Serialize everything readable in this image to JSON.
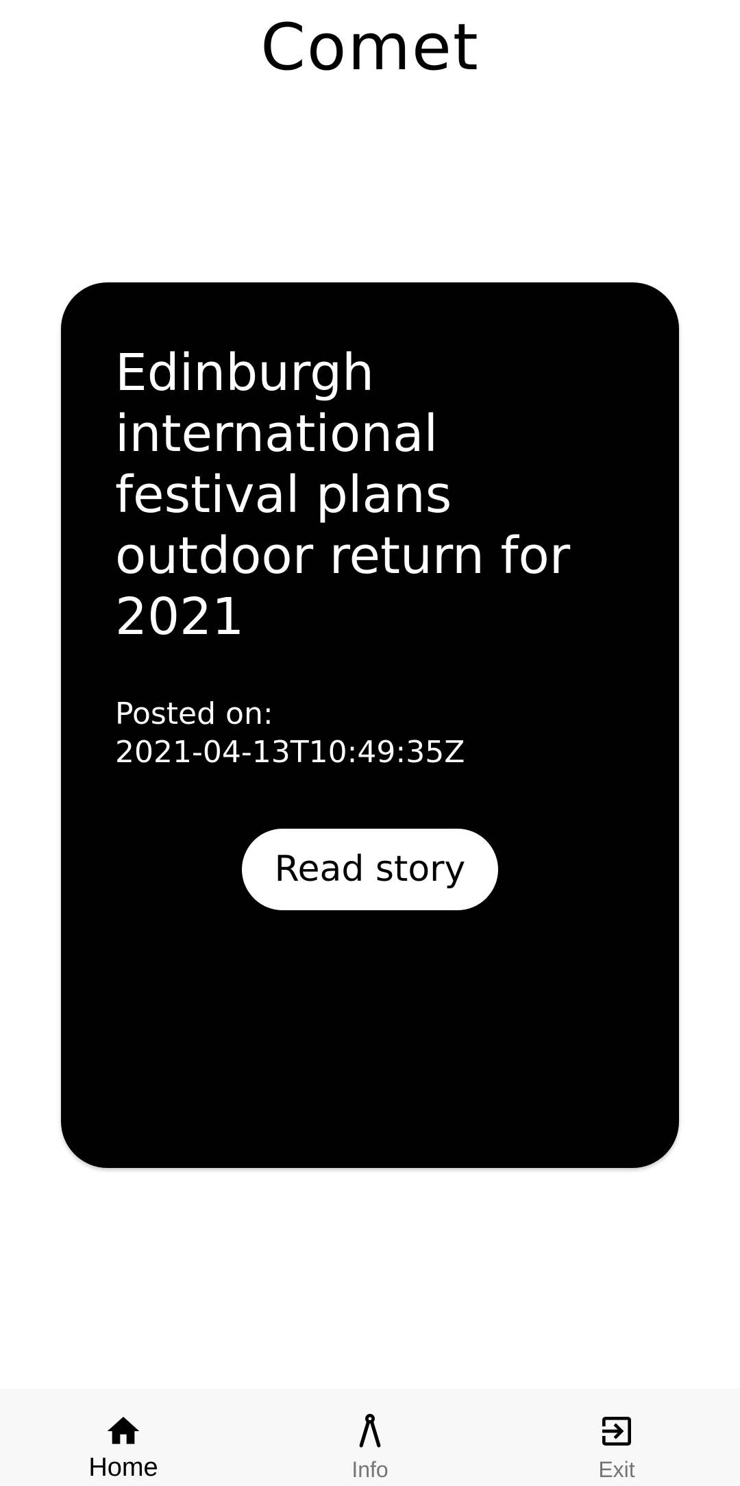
{
  "app": {
    "title": "Comet"
  },
  "story": {
    "title": "Edinburgh international festival plans outdoor return for 2021",
    "posted_label": "Posted on:",
    "posted_date": "2021-04-13T10:49:35Z",
    "read_button_label": "Read story"
  },
  "bottom_nav": {
    "items": [
      {
        "label": "Home",
        "icon": "home-icon",
        "active": true
      },
      {
        "label": "Info",
        "icon": "compass-icon",
        "active": false
      },
      {
        "label": "Exit",
        "icon": "exit-icon",
        "active": false
      }
    ]
  },
  "colors": {
    "background": "#ffffff",
    "card": "#000000",
    "card_text": "#ffffff",
    "nav_background": "#f8f8f8",
    "nav_active": "#000000",
    "nav_inactive": "#757575"
  }
}
